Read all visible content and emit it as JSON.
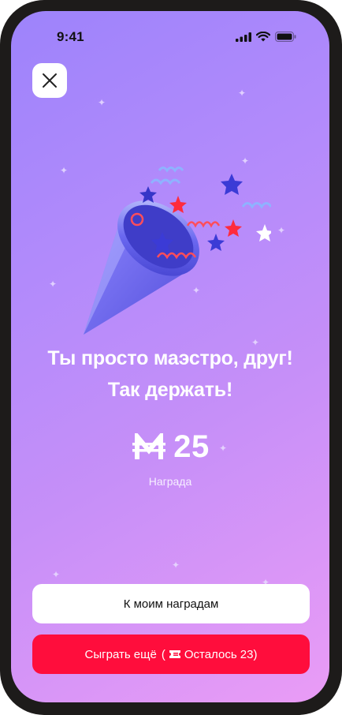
{
  "status_bar": {
    "time": "9:41",
    "icons": [
      "signal-icon",
      "wifi-icon",
      "battery-icon"
    ]
  },
  "close_button": {
    "icon": "close-icon"
  },
  "message": {
    "line1": "Ты просто маэстро, друг!",
    "line2": "Так держать!"
  },
  "reward": {
    "currency_symbol": "M",
    "amount": "25",
    "caption": "Награда"
  },
  "buttons": {
    "my_rewards_label": "К моим наградам",
    "play_again_label": "Сыграть ещё",
    "remaining_prefix": "(",
    "remaining_label": "Осталось 23)"
  },
  "colors": {
    "accent": "#ff0d3c",
    "background_start": "#9d83fb",
    "background_end": "#ea9cf6"
  }
}
